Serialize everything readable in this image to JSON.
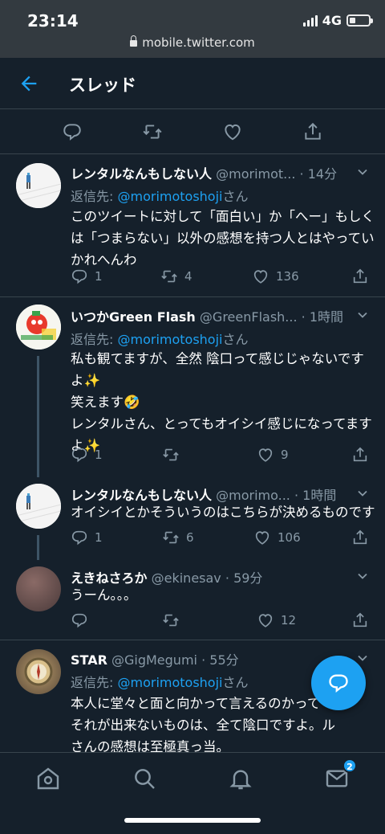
{
  "status": {
    "time": "23:14",
    "network": "4G",
    "url": "mobile.twitter.com",
    "battery_level": 0.3
  },
  "header": {
    "title": "スレッド"
  },
  "main_actions": [
    "reply-icon",
    "retweet-icon",
    "like-icon",
    "share-icon"
  ],
  "tweets": [
    {
      "name": "レンタルなんもしない人",
      "handle": "@morimot...",
      "time": "14分",
      "reply_prefix": "返信先: ",
      "reply_mention": "@morimotoshoji",
      "reply_suffix": "さん",
      "text": "このツイートに対して「面白い」か「へー」もしくは「つまらない」以外の感想を持つ人とはやっていかれへんわ",
      "replies": "1",
      "retweets": "4",
      "likes": "136"
    },
    {
      "name": "いつかGreen Flash",
      "handle": "@GreenFlash...",
      "time": "1時間",
      "reply_prefix": "返信先: ",
      "reply_mention": "@morimotoshoji",
      "reply_suffix": "さん",
      "text": "私も観てますが、全然 陰口って感じじゃないですよ✨\n笑えます🤣\nレンタルさん、とってもオイシイ感じになってますよ✨",
      "replies": "1",
      "retweets": "",
      "likes": "9"
    },
    {
      "name": "レンタルなんもしない人",
      "handle": "@morimo...",
      "time": "1時間",
      "text": "オイシイとかそういうのはこちらが決めるものです",
      "replies": "1",
      "retweets": "6",
      "likes": "106"
    },
    {
      "name": "えきねさろか",
      "handle": "@ekinesav",
      "time": "59分",
      "text": "うーん。。。",
      "replies": "",
      "retweets": "",
      "likes": "12"
    },
    {
      "name": "STAR",
      "handle": "@GigMegumi",
      "time": "55分",
      "reply_prefix": "返信先: ",
      "reply_mention": "@morimotoshoji",
      "reply_suffix": "さん",
      "text": "本人に堂々と面と向かって言えるのかって\nそれが出来ないものは、全て陰口ですよ。ル\nさんの感想は至極真っ当。"
    }
  ],
  "fab": {
    "icon": "compose-reply-icon"
  },
  "bottom_nav": {
    "items": [
      "home-icon",
      "search-icon",
      "notifications-icon",
      "messages-icon"
    ],
    "messages_badge": "2"
  },
  "colors": {
    "background": "#15202b",
    "accent": "#1da1f2",
    "muted": "#8899a6",
    "border": "#38444d"
  }
}
